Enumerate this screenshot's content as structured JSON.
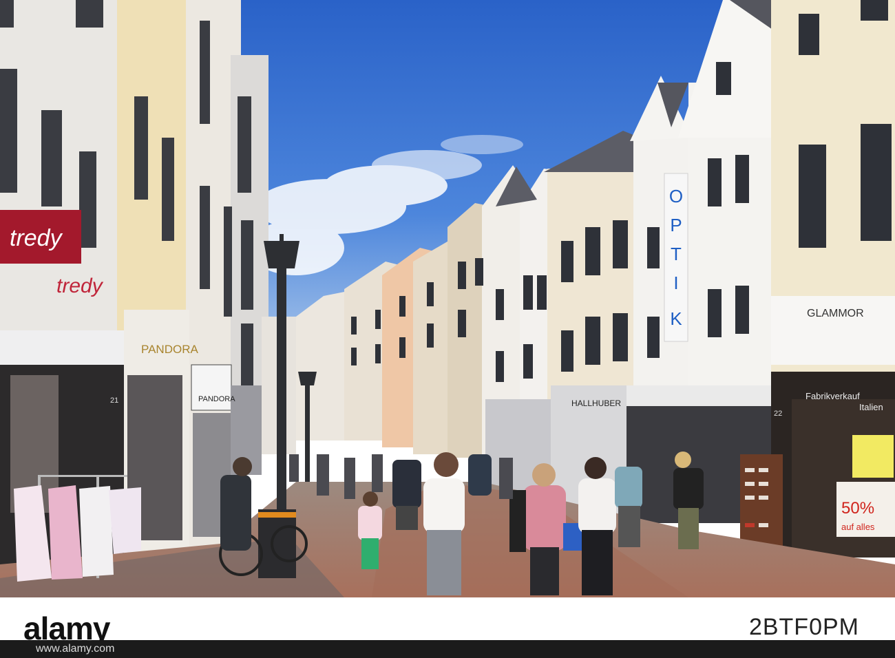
{
  "photo": {
    "signs": {
      "tredy_top": "tredy",
      "tredy_lower": "tredy",
      "pandora_upper": "PANDORA",
      "pandora_box": "PANDORA",
      "optik": "OPTIK",
      "glammor": "GLAMMOR",
      "hallhuber": "HALLHUBER",
      "fabrikverkauf": "Fabrikverkauf",
      "italien": "Italien",
      "sale": "50%",
      "sale_sub": "auf alles",
      "house_21": "21",
      "house_22": "22"
    }
  },
  "watermark": {
    "logo": "alamy",
    "image_id": "2BTF0PM",
    "url": "www.alamy.com"
  },
  "colors": {
    "sky_top": "#2f66c9",
    "sky_bottom": "#8bb3e6",
    "pavement": "#b07c68",
    "optik_blue": "#1f5fc4"
  }
}
